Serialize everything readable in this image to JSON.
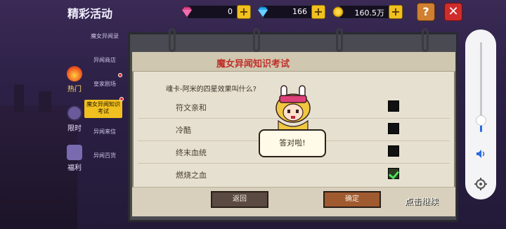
{
  "header": {
    "title": "精彩活动"
  },
  "resources": [
    {
      "name": "pink-gem",
      "value": "0",
      "color": "#e0458a"
    },
    {
      "name": "blue-gem",
      "value": "166",
      "color": "#2aa8f0"
    },
    {
      "name": "gold-coin",
      "value": "160.5万",
      "color": "#f0c020"
    }
  ],
  "buttons": {
    "help": "?",
    "close": "✕"
  },
  "left_tabs": [
    {
      "label": "热门",
      "icon": "fire-icon"
    },
    {
      "label": "限时",
      "icon": "clock-icon"
    },
    {
      "label": "福利",
      "icon": "gift-icon"
    }
  ],
  "menu": [
    {
      "label": "魔女异闻录"
    },
    {
      "label": "异闻商店"
    },
    {
      "label": "皇家剧场"
    },
    {
      "label": "魔女异闻知识考试"
    },
    {
      "label": "异闻来信"
    },
    {
      "label": "异闻百货"
    }
  ],
  "quiz": {
    "title": "魔女异闻知识考试",
    "question": "魂卡-阿米的四星效果叫什么?",
    "options": [
      {
        "label": "符文亲和",
        "checked": false
      },
      {
        "label": "冷酷",
        "checked": false
      },
      {
        "label": "终末血统",
        "checked": false
      },
      {
        "label": "燃烧之血",
        "checked": true
      }
    ],
    "feedback": "答对啦!",
    "back_label": "返回",
    "confirm_label": "确定",
    "continue_label": "点击继续"
  },
  "colors": {
    "accent": "#f0c020",
    "title_red": "#c0302a",
    "check_green": "#4adf58"
  }
}
